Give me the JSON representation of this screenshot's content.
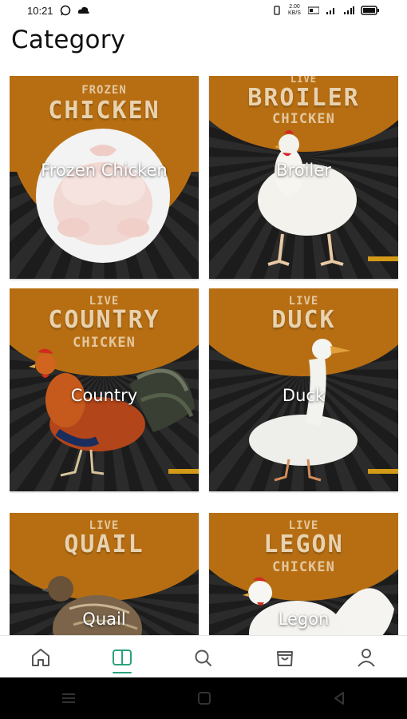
{
  "status_bar": {
    "time": "10:21",
    "left_icons": [
      "whatsapp-icon",
      "cloud-icon"
    ],
    "right_text": "2.00 KB/S",
    "right_icons": [
      "vibrate-icon",
      "volte-icon",
      "signal-icon",
      "wifi-signal-icon",
      "battery-icon"
    ]
  },
  "header": {
    "title": "Category"
  },
  "categories": [
    {
      "poster_top": "FROZEN",
      "poster_main": "CHICKEN",
      "poster_sub": "",
      "label": "Frozen Chicken"
    },
    {
      "poster_top": "LIVE",
      "poster_main": "BROILER",
      "poster_sub": "CHICKEN",
      "label": "Broiler"
    },
    {
      "poster_top": "LIVE",
      "poster_main": "COUNTRY",
      "poster_sub": "CHICKEN",
      "label": "Country"
    },
    {
      "poster_top": "LIVE",
      "poster_main": "DUCK",
      "poster_sub": "",
      "label": "Duck"
    },
    {
      "poster_top": "LIVE",
      "poster_main": "QUAIL",
      "poster_sub": "",
      "label": "Quail"
    },
    {
      "poster_top": "LIVE",
      "poster_main": "LEGON",
      "poster_sub": "CHICKEN",
      "label": "Legon"
    }
  ],
  "bottom_nav": {
    "items": [
      {
        "icon": "home-icon",
        "active": false
      },
      {
        "icon": "book-icon",
        "active": true
      },
      {
        "icon": "search-icon",
        "active": false
      },
      {
        "icon": "shopping-bag-icon",
        "active": false
      },
      {
        "icon": "profile-icon",
        "active": false
      }
    ],
    "active_color": "#2aa37f"
  },
  "colors": {
    "poster_orange": "#b76e12",
    "poster_dark": "#1f1f1f",
    "accent": "#2aa37f"
  }
}
